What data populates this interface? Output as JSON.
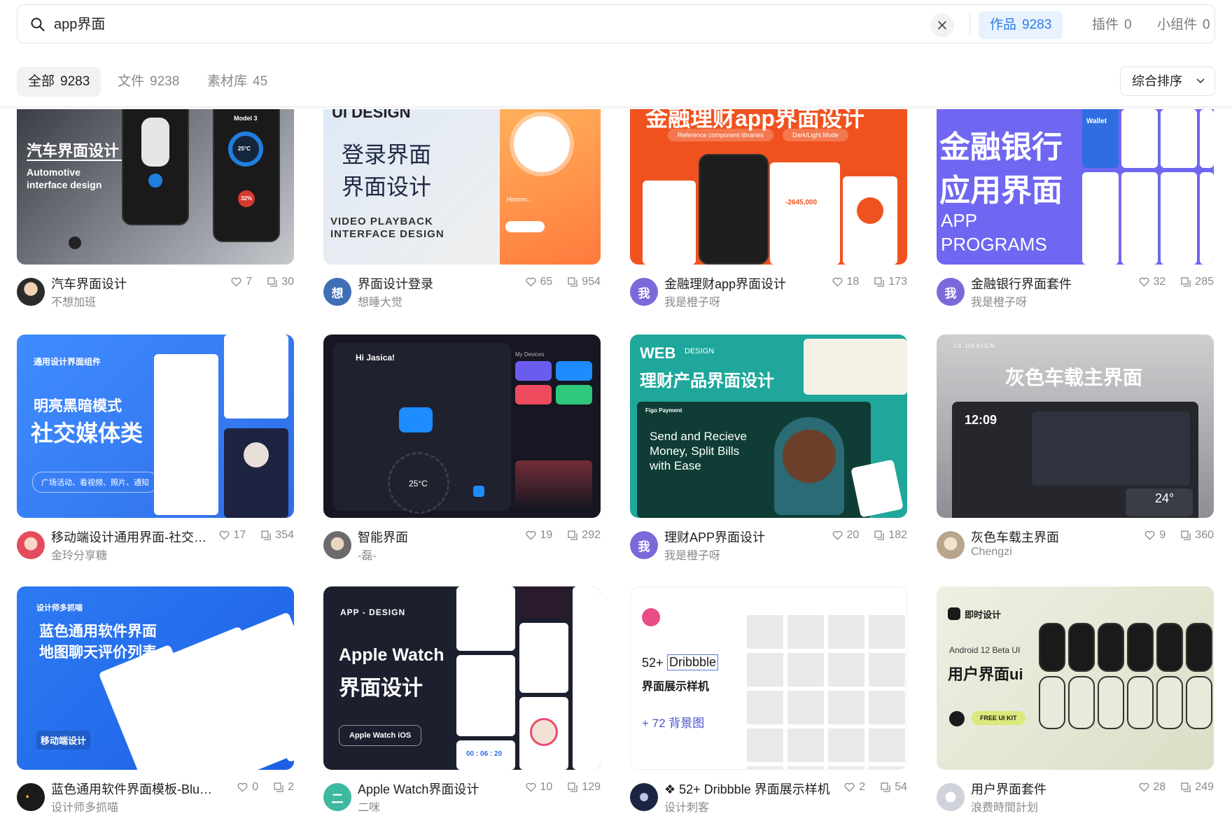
{
  "search": {
    "query": "app界面",
    "tabs": [
      {
        "label": "作品",
        "count": "9283"
      },
      {
        "label": "插件",
        "count": "0"
      },
      {
        "label": "小组件",
        "count": "0"
      }
    ]
  },
  "filters": {
    "tabs": [
      {
        "label": "全部",
        "count": "9283"
      },
      {
        "label": "文件",
        "count": "9238"
      },
      {
        "label": "素材库",
        "count": "45"
      }
    ],
    "sort_label": "综合排序"
  },
  "cards": [
    {
      "title": "汽车界面设计",
      "author": "不想加班",
      "likes": "7",
      "copies": "30",
      "thumb": {
        "line1": "汽车界面设计",
        "line2": "Automotive",
        "line3": "interface design",
        "phone_label": "Model 3",
        "temp": "25°C",
        "percent": "32%"
      }
    },
    {
      "title": "界面设计登录",
      "author": "想睡大觉",
      "avatar_text": "想",
      "likes": "65",
      "copies": "954",
      "thumb": {
        "top": "UI DESIGN",
        "line1": "登录界面",
        "line2": "界面设计",
        "line3": "VIDEO PLAYBACK",
        "line4": "INTERFACE DESIGN",
        "phone_text": "Hmmm..."
      }
    },
    {
      "title": "金融理财app界面设计",
      "author": "我是橙子呀",
      "avatar_text": "我",
      "likes": "18",
      "copies": "173",
      "thumb": {
        "heading": "金融理财app界面设计",
        "pill1": "Reference component libraries",
        "pill2": "Dark/Light Mode",
        "amount": "-2645,000"
      }
    },
    {
      "title": "金融银行界面套件",
      "author": "我是橙子呀",
      "avatar_text": "我",
      "likes": "32",
      "copies": "285",
      "thumb": {
        "line1": "金融银行",
        "line2": "应用界面",
        "line3": "APP",
        "line4": "PROGRAMS",
        "wallet": "Wallet"
      }
    },
    {
      "title": "移动端设计通用界面-社交媒体类",
      "author": "金玲分享糖",
      "likes": "17",
      "copies": "354",
      "thumb": {
        "small": "通用设计界面组件",
        "line1": "明亮黑暗模式",
        "line2": "社交媒体类",
        "pill": "广场活动、看视频、照片、通知"
      }
    },
    {
      "title": "智能界面",
      "author": "-磊-",
      "likes": "19",
      "copies": "292",
      "thumb": {
        "greeting": "Hi Jasica!",
        "temp": "25°C",
        "devices": "My Devices"
      }
    },
    {
      "title": "理财APP界面设计",
      "author": "我是橙子呀",
      "avatar_text": "我",
      "likes": "20",
      "copies": "182",
      "thumb": {
        "web": "WEB",
        "design": "DESIGN",
        "line1": "理财产品界面设计",
        "brand": "Figo Payment",
        "tag1": "Send and Recieve",
        "tag2": "Money, Split Bills",
        "tag3": "with Ease"
      }
    },
    {
      "title": "灰色车载主界面",
      "author": "Chengzi",
      "likes": "9",
      "copies": "360",
      "thumb": {
        "top": "JS DESIGN",
        "line1": "灰色车载主界面",
        "time": "12:09",
        "temp": "24°"
      }
    },
    {
      "title": "蓝色通用软件界面模板-Blue Mobile UI",
      "author": "设计师多抓喵",
      "likes": "0",
      "copies": "2",
      "thumb": {
        "small": "设计师多抓喵",
        "line1": "蓝色通用软件界面",
        "line2": "地图聊天评价列表",
        "badge": "移动端设计"
      }
    },
    {
      "title": "Apple Watch界面设计",
      "author": "二咪",
      "avatar_text": "二",
      "likes": "10",
      "copies": "129",
      "thumb": {
        "small": "APP - DESIGN",
        "line1": "Apple Watch",
        "line2": "界面设计",
        "pill": "Apple Watch iOS",
        "timer": "00 : 06 : 20"
      }
    },
    {
      "title": "❖ 52+ Dribbble 界面展示样机",
      "author": "设计刺客",
      "likes": "2",
      "copies": "54",
      "thumb": {
        "line1": "52+",
        "line1b": "Dribbble",
        "line2": "界面展示样机",
        "line3": "+ 72 背景图"
      }
    },
    {
      "title": "用户界面套件",
      "author": "浪费時間計划",
      "likes": "28",
      "copies": "249",
      "thumb": {
        "brand": "即时设计",
        "small": "Android 12 Beta UI",
        "line1": "用户界面ui",
        "pill": "FREE UI KIT"
      }
    }
  ],
  "colors": {
    "accent": "#2a7be6",
    "accent_bg": "#e8f2fe",
    "muted": "#8a8a8a"
  }
}
